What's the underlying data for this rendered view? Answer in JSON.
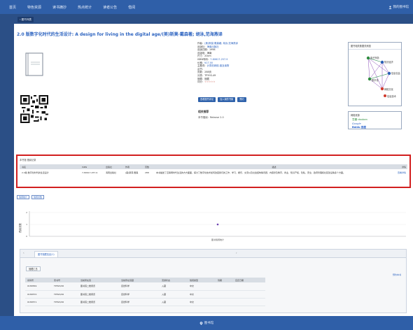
{
  "topnav": {
    "items": [
      "首页",
      "特色资源",
      "读书摘抄",
      "热点统计",
      "读者公告",
      "借阅"
    ],
    "account": "我的图书馆"
  },
  "back_label": "‹ 图书列表",
  "book": {
    "title": "2.0 版数字化时代的生活设计: A design for living in the digital age/(美)斯莫·戴森著; 胡泳,范海燕译"
  },
  "meta_rows": [
    {
      "label": "作者：",
      "value": "(美)斯莫·戴森著; 胡泳,范海燕译",
      "kind": "lnk"
    },
    {
      "label": "出版社：",
      "value": "海南出版社",
      "kind": "lnk"
    },
    {
      "label": "出版日期：",
      "value": "1998",
      "kind": "txt"
    },
    {
      "label": "出版地：",
      "value": "海南",
      "kind": "txt"
    },
    {
      "label": "尺寸：",
      "value": "20cm",
      "kind": "txt"
    },
    {
      "label": "ISBN号码：",
      "value": "7-80617-257-9",
      "kind": "lnk"
    },
    {
      "label": "价格：",
      "value": "¥17.00",
      "kind": "lnk"
    },
    {
      "label": "主题词：",
      "value": "计算机网络-普及读物",
      "kind": "lnk"
    },
    {
      "label": "丛书：",
      "value": "",
      "kind": "txt"
    },
    {
      "label": "页数：",
      "value": "288页",
      "kind": "txt"
    },
    {
      "label": "分类：",
      "value": "TP393-49",
      "kind": "txt"
    },
    {
      "label": "馆藏：",
      "value": "馆藏",
      "kind": "txt"
    },
    {
      "label": "评分：",
      "value": "☆☆☆☆☆",
      "kind": "red"
    }
  ],
  "action_buttons": [
    "查看图书评论",
    "加入我的书架",
    "预约"
  ],
  "summary": {
    "heading": "相关推荐",
    "text": "本书借阅：Release 2.0"
  },
  "graph_panel": {
    "title": "图书相关数据关系图",
    "nodes": [
      "电子商务",
      "知识经济",
      "信息社会",
      "数字化",
      "网络文化",
      "信息技术"
    ]
  },
  "resources": {
    "title": "网络资源",
    "items": [
      "豆瓣 douban",
      "Google",
      "Baidu 百度"
    ]
  },
  "holdings_summary": {
    "title": "本书馆 借阅记录",
    "headers": [
      "书名",
      "ISBN",
      "出版社",
      "作者",
      "页数",
      "描述",
      "详情"
    ],
    "row": {
      "name": "2.0版·数字化时代的生活设计",
      "isbn": "7-80617-257-9",
      "publisher": "海南出版社",
      "author": "(美)斯莫·戴森",
      "pages": "288",
      "desc": "本书描述了互联网时代生活的方方面面，探讨了数字化技术如何改变我们的工作、学习、娱乐、交流以及社会结构等问题，内容涉及教育、商业、知识产权、隐私、安全、政府管理和社区建设等多个方面。",
      "op": "查看详情"
    }
  },
  "chips": [
    "借阅统计",
    "借阅次数"
  ],
  "chart_data": {
    "type": "scatter",
    "ylabel": "借阅次数",
    "xlabel": "",
    "x": [
      "图书借阅统计"
    ],
    "y": [
      1
    ],
    "ylim": [
      0,
      2
    ],
    "yticks": [
      "2",
      "1",
      "0"
    ]
  },
  "lower": {
    "tab_label": "图书馆藏信息(1)",
    "hold_button": "馆藏汇总",
    "reserve_link": "预约本书",
    "headers": [
      "条码号",
      "索书号",
      "当前所在馆",
      "当前所在馆藏",
      "流通状态",
      "借阅类型",
      "到期",
      "应还日期"
    ],
    "rows": [
      [
        "0180569",
        "TP393/26",
        "图书馆二楼阅览",
        "自然科学",
        "入藏",
        "中文",
        "",
        ""
      ],
      [
        "0180570",
        "TP393/26",
        "图书馆二楼阅览",
        "自然科学",
        "入藏",
        "中文",
        "",
        ""
      ],
      [
        "0180571",
        "TP393/26",
        "图书馆二楼阅览",
        "自然科学",
        "入藏",
        "中文",
        "",
        ""
      ]
    ]
  },
  "footer": "图书馆",
  "colors": {
    "nav": "#2f5fa8",
    "bg": "#2b4f86",
    "highlight": "#d21f1f",
    "link": "#2c63c0"
  }
}
